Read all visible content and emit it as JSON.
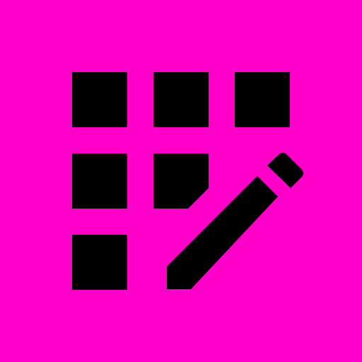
{
  "icon": {
    "name": "grid-edit-icon",
    "background_color": "#FF00C8",
    "foreground_color": "#000000"
  }
}
